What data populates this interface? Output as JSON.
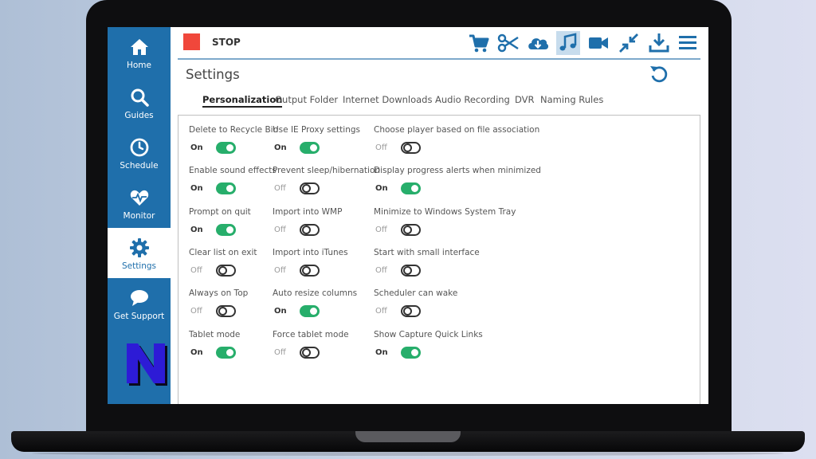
{
  "colors": {
    "sidebar_bg": "#1f6fab",
    "toolbar_icon": "#1f6fab",
    "stop_red": "#f0473b",
    "toggle_on": "#27ae6b"
  },
  "sidebar": {
    "items": [
      {
        "label": "Home",
        "icon": "home-icon"
      },
      {
        "label": "Guides",
        "icon": "search-icon"
      },
      {
        "label": "Schedule",
        "icon": "clock-icon"
      },
      {
        "label": "Monitor",
        "icon": "heart-pulse-icon"
      },
      {
        "label": "Settings",
        "icon": "gear-icon",
        "active": true
      },
      {
        "label": "Get Support",
        "icon": "chat-bubble-icon"
      }
    ],
    "logo_icon": "n-logo-icon"
  },
  "toolbar": {
    "stop_label": "STOP",
    "icons": [
      "cart-icon",
      "scissors-icon",
      "cloud-download-icon",
      "music-note-icon",
      "video-camera-icon",
      "compress-arrows-icon",
      "download-tray-icon",
      "hamburger-menu-icon"
    ],
    "active_icon": "music-note-icon"
  },
  "page": {
    "title": "Settings",
    "reset_icon": "reset-icon"
  },
  "tabs": [
    {
      "label": "Personalization",
      "active": true
    },
    {
      "label": "Output Folder"
    },
    {
      "label": "Internet Downloads"
    },
    {
      "label": "Audio Recording"
    },
    {
      "label": "DVR"
    },
    {
      "label": "Naming Rules"
    }
  ],
  "settings": [
    [
      {
        "label": "Delete to Recycle Bin",
        "state": "On"
      },
      {
        "label": "Enable sound effects",
        "state": "On"
      },
      {
        "label": "Prompt on quit",
        "state": "On"
      },
      {
        "label": "Clear list on exit",
        "state": "Off"
      },
      {
        "label": "Always on Top",
        "state": "Off"
      },
      {
        "label": "Tablet mode",
        "state": "On"
      }
    ],
    [
      {
        "label": "Use IE Proxy settings",
        "state": "On"
      },
      {
        "label": "Prevent sleep/hibernation",
        "state": "Off"
      },
      {
        "label": "Import into WMP",
        "state": "Off"
      },
      {
        "label": "Import into iTunes",
        "state": "Off"
      },
      {
        "label": "Auto resize columns",
        "state": "On"
      },
      {
        "label": "Force tablet mode",
        "state": "Off"
      }
    ],
    [
      {
        "label": "Choose player based on file association",
        "state": "Off"
      },
      {
        "label": "Display progress alerts when minimized",
        "state": "On"
      },
      {
        "label": "Minimize to Windows System Tray",
        "state": "Off"
      },
      {
        "label": "Start with small interface",
        "state": "Off"
      },
      {
        "label": "Scheduler can wake",
        "state": "Off"
      },
      {
        "label": "Show Capture Quick Links",
        "state": "On"
      }
    ]
  ]
}
